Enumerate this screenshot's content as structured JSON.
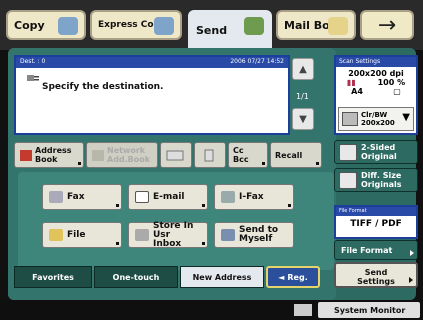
{
  "tabs": [
    {
      "label": "Copy"
    },
    {
      "label": "Express Copy"
    },
    {
      "label": "Send"
    },
    {
      "label": "Mail Box"
    }
  ],
  "destination": {
    "header_left": "Dest. :   0",
    "header_right": "2006 07/27  14:52",
    "message": "Specify the destination.",
    "page": "1/1"
  },
  "function_row": {
    "address_book": "Address Book",
    "network_address_book": "Network Add.Book",
    "cc_bcc": "Cc Bcc",
    "recall": "Recall"
  },
  "address_types": {
    "fax": "Fax",
    "email": "E-mail",
    "ifax": "I-Fax",
    "file": "File",
    "store_in_user_inbox": "Store In Usr Inbox",
    "send_to_myself": "Send to Myself"
  },
  "bottom_tabs": {
    "favorites": "Favorites",
    "one_touch": "One-touch",
    "new_address": "New Address",
    "reg": "Reg."
  },
  "scan_settings": {
    "header": "Scan Settings",
    "resolution": "200x200 dpi",
    "zoom": "100 %",
    "paper": "A4",
    "color_mode": "Clr/BW",
    "color_res": "200x200"
  },
  "right_buttons": {
    "two_sided": "2-Sided Original",
    "diff_size": "Diff. Size Originals"
  },
  "file_format": {
    "header": "File Format",
    "value": "TIFF / PDF",
    "button": "File Format"
  },
  "send_settings": "Send Settings",
  "status": {
    "system_monitor": "System Monitor"
  }
}
